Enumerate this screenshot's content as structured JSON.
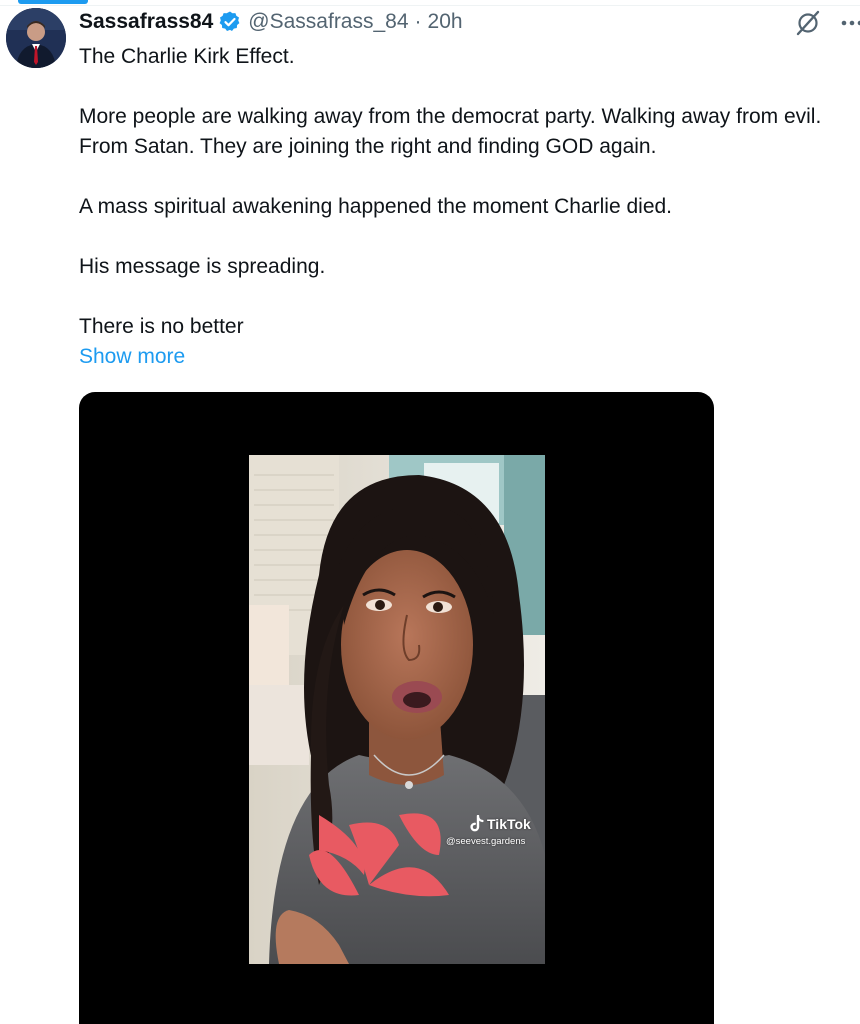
{
  "tweet": {
    "display_name": "Sassafrass84",
    "handle": "@Sassafrass_84",
    "separator": "·",
    "timestamp": "20h",
    "paragraphs": [
      "The Charlie Kirk Effect.",
      "More people are walking away from the democrat party. Walking away from evil. From Satan. They are joining the right and finding GOD again.",
      "A mass spiritual awakening happened the moment Charlie died.",
      "His message is spreading.",
      "There is no better"
    ],
    "show_more_label": "Show more"
  },
  "media": {
    "watermark_app": "TikTok",
    "watermark_user": "@seevest.gardens"
  },
  "icons": {
    "verified": "verified-badge-icon",
    "grok": "grok-icon",
    "more": "more-horizontal-icon"
  },
  "colors": {
    "accent": "#1d9bf0",
    "text_primary": "#0f1419",
    "text_secondary": "#536471",
    "media_bg": "#000000"
  }
}
